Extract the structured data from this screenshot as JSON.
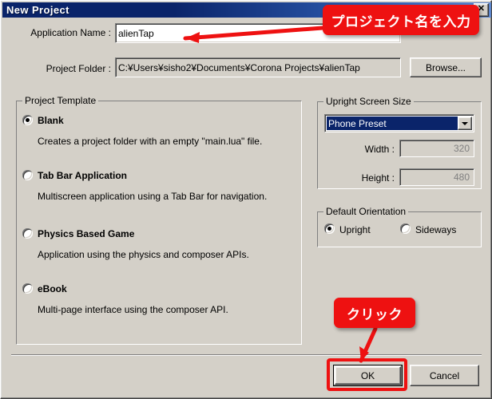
{
  "window": {
    "title": "New Project",
    "close_label": "✕"
  },
  "form": {
    "app_name_label": "Application Name :",
    "app_name_value": "alienTap",
    "project_folder_label": "Project Folder :",
    "project_folder_value": "C:¥Users¥sisho2¥Documents¥Corona Projects¥alienTap",
    "browse_label": "Browse..."
  },
  "project_template": {
    "group_title": "Project Template",
    "options": [
      {
        "label": "Blank",
        "description": "Creates a project folder with an empty \"main.lua\" file.",
        "selected": true
      },
      {
        "label": "Tab Bar Application",
        "description": "Multiscreen application using a Tab Bar for navigation.",
        "selected": false
      },
      {
        "label": "Physics Based Game",
        "description": "Application using the physics and composer APIs.",
        "selected": false
      },
      {
        "label": "eBook",
        "description": "Multi-page interface using the composer API.",
        "selected": false
      }
    ]
  },
  "screen_size": {
    "group_title": "Upright Screen Size",
    "preset_value": "Phone Preset",
    "width_label": "Width :",
    "width_value": "320",
    "height_label": "Height :",
    "height_value": "480"
  },
  "orientation": {
    "group_title": "Default Orientation",
    "options": [
      {
        "label": "Upright",
        "selected": true
      },
      {
        "label": "Sideways",
        "selected": false
      }
    ]
  },
  "buttons": {
    "ok_label": "OK",
    "cancel_label": "Cancel"
  },
  "annotations": {
    "name_callout": "プロジェクト名を入力",
    "click_callout": "クリック",
    "accent_color": "#ee1111"
  }
}
